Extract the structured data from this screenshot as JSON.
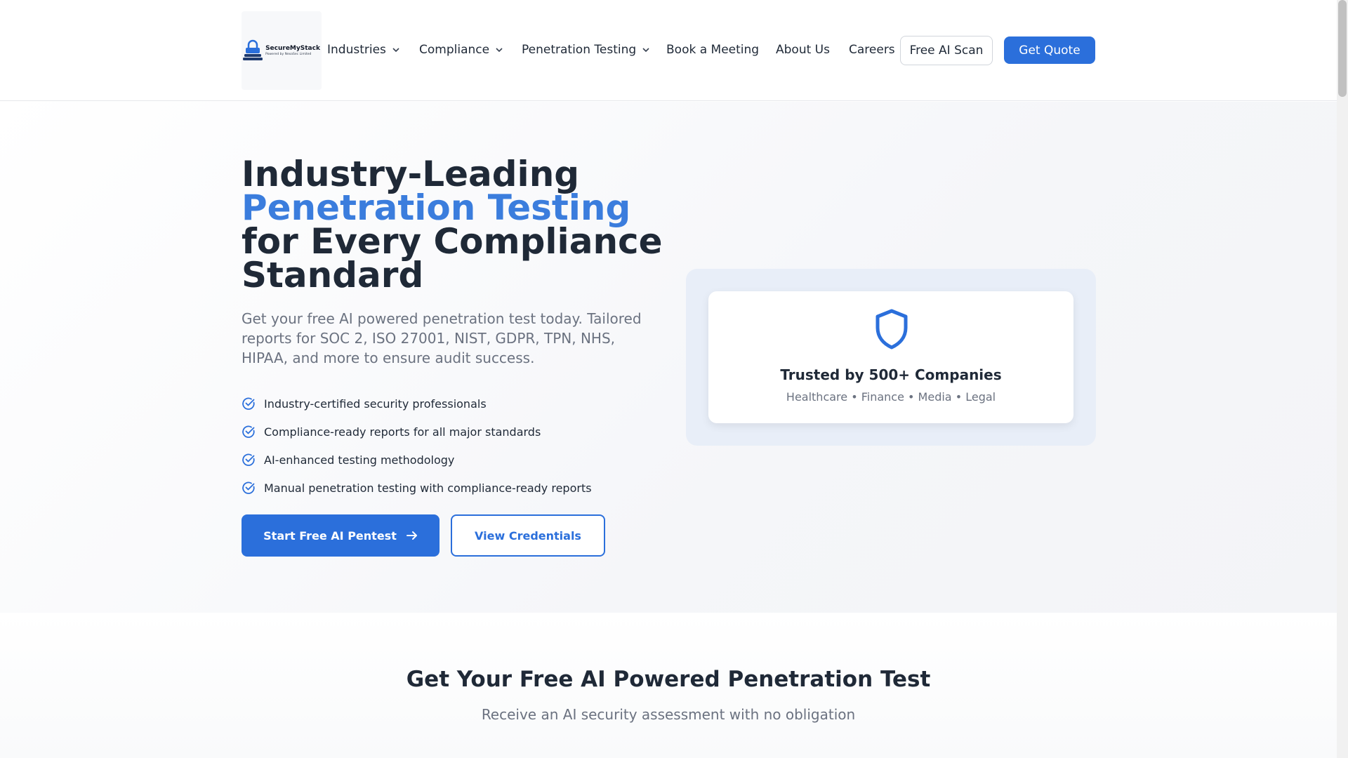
{
  "brand": {
    "name": "SecureMyStack",
    "tagline": "Powered by NexaSec Limited"
  },
  "nav": {
    "items": [
      {
        "label": "Industries"
      },
      {
        "label": "Compliance"
      },
      {
        "label": "Penetration Testing"
      },
      {
        "label": "Book a Meeting"
      },
      {
        "label": "About Us"
      },
      {
        "label": "Careers"
      }
    ],
    "free_scan_label": "Free AI Scan",
    "quote_label": "Get Quote"
  },
  "hero": {
    "title_line1": "Industry-Leading",
    "title_line2": "Penetration Testing",
    "title_line3": "for Every Compliance",
    "title_line4": "Standard",
    "subtitle": "Get your free AI powered penetration test today. Tailored reports for SOC 2, ISO 27001, NIST, GDPR, TPN, NHS, HIPAA, and more to ensure audit success.",
    "features": [
      "Industry-certified security professionals",
      "Compliance-ready reports for all major standards",
      "AI-enhanced testing methodology",
      "Manual penetration testing with compliance-ready reports"
    ],
    "primary_cta": "Start Free AI Pentest",
    "secondary_cta": "View Credentials"
  },
  "trust_card": {
    "title": "Trusted by 500+ Companies",
    "subtitle": "Healthcare • Finance • Media • Legal",
    "icon": "shield-icon"
  },
  "section2": {
    "title": "Get Your Free AI Powered Penetration Test",
    "subtitle": "Receive an AI security assessment with no obligation"
  },
  "colors": {
    "accent": "#2b6fdb",
    "accent_light": "#3b7ddd",
    "text": "#1f2937",
    "muted": "#6b7280"
  }
}
